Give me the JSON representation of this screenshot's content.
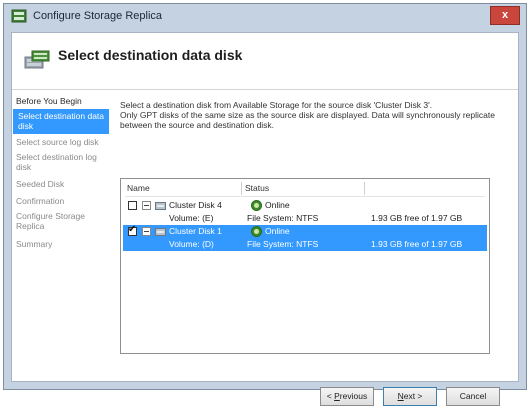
{
  "window": {
    "title": "Configure Storage Replica",
    "close_glyph": "x",
    "icon": "server-icon"
  },
  "header": {
    "title": "Select destination data disk",
    "icon": "storage-replica-icon"
  },
  "nav": {
    "items": [
      {
        "label": "Before You Begin"
      },
      {
        "label": "Select destination data disk"
      },
      {
        "label": "Select source log disk"
      },
      {
        "label": "Select destination log disk"
      },
      {
        "label": "Seeded Disk"
      },
      {
        "label": "Confirmation"
      },
      {
        "label": "Configure Storage Replica"
      },
      {
        "label": "Summary"
      }
    ]
  },
  "description": {
    "line1": "Select a destination disk from Available Storage for the source disk 'Cluster Disk 3'.",
    "line2": "Only GPT disks of the same size as the source disk are displayed. Data will synchronously replicate",
    "line3": "between the source and destination disk."
  },
  "table": {
    "columns": [
      "Name",
      "Status"
    ],
    "rows": [
      {
        "name": "Cluster Disk 4",
        "status": "Online",
        "checked": false,
        "selected": false,
        "volume": "Volume: (E)",
        "filesystem": "File System: NTFS",
        "free": "1.93 GB free of 1.97 GB"
      },
      {
        "name": "Cluster Disk 1",
        "status": "Online",
        "checked": true,
        "selected": true,
        "volume": "Volume: (D)",
        "filesystem": "File System: NTFS",
        "free": "1.93 GB free of 1.97 GB"
      }
    ]
  },
  "buttons": {
    "previous": {
      "prefix": "< ",
      "accel": "P",
      "rest": "revious"
    },
    "next": {
      "accel": "N",
      "rest": "ext >"
    },
    "cancel": "Cancel"
  },
  "colors": {
    "selection": "#3399ff",
    "window_frame": "#c4d2e2",
    "status_online": "#3b8b2a"
  }
}
